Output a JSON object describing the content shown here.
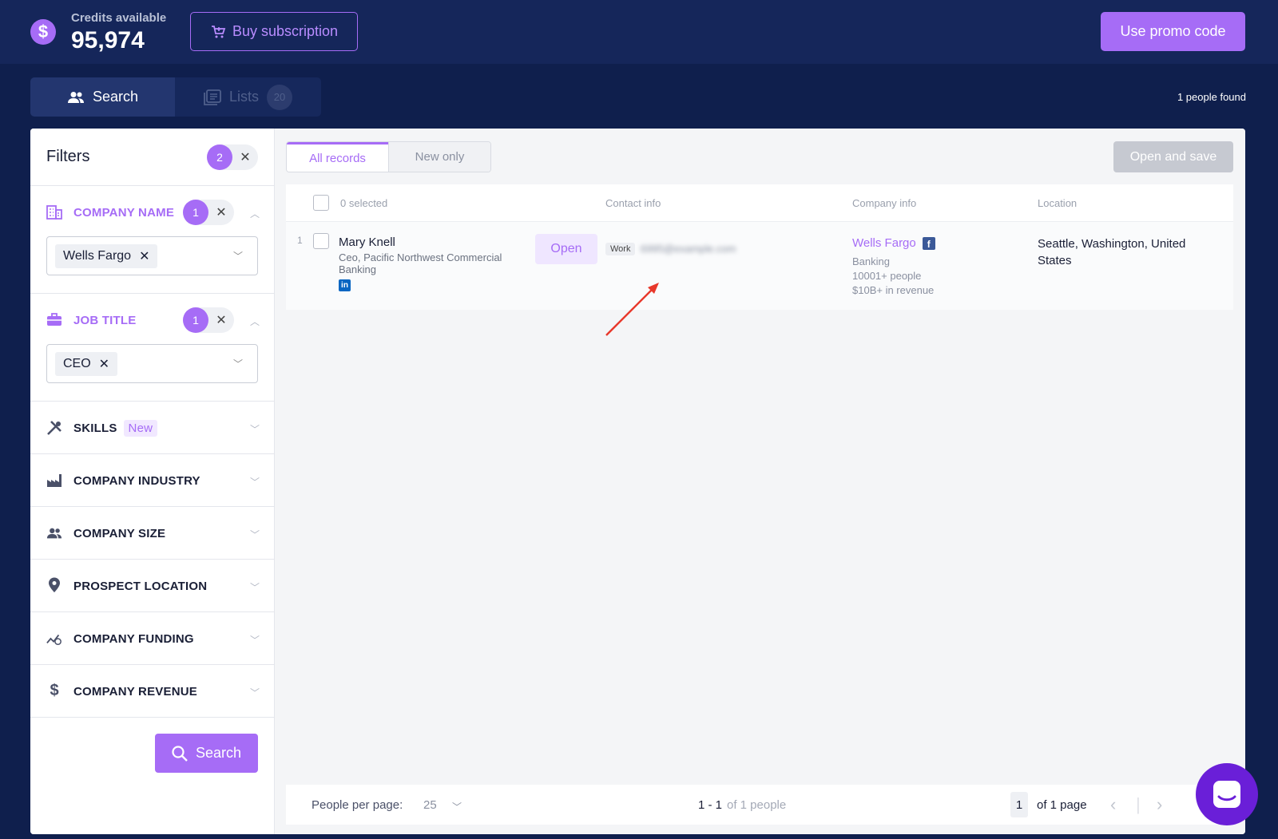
{
  "header": {
    "credits_label": "Credits available",
    "credits_value": "95,974",
    "buy_label": "Buy subscription",
    "promo_label": "Use promo code"
  },
  "tabs": {
    "search_label": "Search",
    "lists_label": "Lists",
    "lists_count": "20"
  },
  "people_found": "1 people found",
  "filters": {
    "title": "Filters",
    "active_count": "2",
    "company_name": {
      "label": "COMPANY NAME",
      "count": "1",
      "tag": "Wells Fargo"
    },
    "job_title": {
      "label": "JOB TITLE",
      "count": "1",
      "tag": "CEO"
    },
    "skills": {
      "label": "SKILLS",
      "badge": "New"
    },
    "items": [
      {
        "label": "COMPANY INDUSTRY"
      },
      {
        "label": "COMPANY SIZE"
      },
      {
        "label": "PROSPECT LOCATION"
      },
      {
        "label": "COMPANY FUNDING"
      },
      {
        "label": "COMPANY REVENUE"
      }
    ],
    "search_button": "Search"
  },
  "results": {
    "segment_all": "All records",
    "segment_new": "New only",
    "open_and_save": "Open and save",
    "selected": "0 selected",
    "columns": {
      "contact": "Contact info",
      "company": "Company info",
      "location": "Location"
    },
    "row": {
      "index": "1",
      "name": "Mary Knell",
      "title": "Ceo, Pacific Northwest Commercial Banking",
      "open_label": "Open",
      "work_tag": "Work",
      "email_blurred": "6995@example.com",
      "company": "Wells Fargo",
      "industry": "Banking",
      "size": "10001+ people",
      "revenue": "$10B+ in revenue",
      "location": "Seattle, Washington, United States"
    },
    "footer": {
      "per_page_label": "People per page:",
      "per_page_value": "25",
      "range": "1 - 1",
      "range_of": "of 1 people",
      "page": "1",
      "page_of": "of 1 page"
    }
  },
  "colors": {
    "accent": "#a66cf6",
    "navy": "#0f1f4d"
  }
}
